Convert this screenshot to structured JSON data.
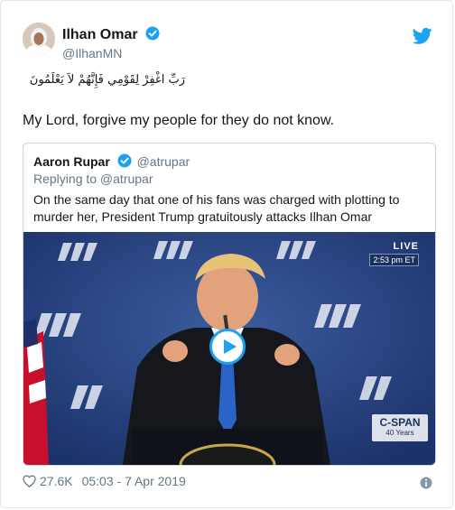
{
  "author": {
    "name": "Ilhan Omar",
    "handle": "@IlhanMN",
    "verified": true,
    "avatar_icon": "profile-photo"
  },
  "brand_icon": "twitter-bird-icon",
  "tweet": {
    "text_arabic": "رَبِّ اغْفِرْ لِقَوْمِي فَإِنَّهُمْ لاَ يَعْلَمُونَ",
    "text": "My Lord, forgive my people for they do not know."
  },
  "quoted_tweet": {
    "author_name": "Aaron Rupar",
    "author_handle": "@atrupar",
    "verified": true,
    "replying_to": "Replying to @atrupar",
    "text": "On the same day that one of his fans was charged with plotting to murder her, President Trump gratuitously attacks Ilhan Omar",
    "video": {
      "live_label": "LIVE",
      "timestamp": "2:53 pm ET",
      "network": "C-SPAN",
      "network_sub": "40 Years",
      "play_icon": "play-icon"
    }
  },
  "footer": {
    "likes": "27.6K",
    "time": "05:03 - 7 Apr 2019",
    "like_icon": "heart-icon",
    "info_icon": "info-icon"
  },
  "colors": {
    "accent": "#1da1f2",
    "text": "#14171a",
    "secondary_text": "#657786",
    "border": "#e1e8ed",
    "video_bg": "#243f7a"
  }
}
